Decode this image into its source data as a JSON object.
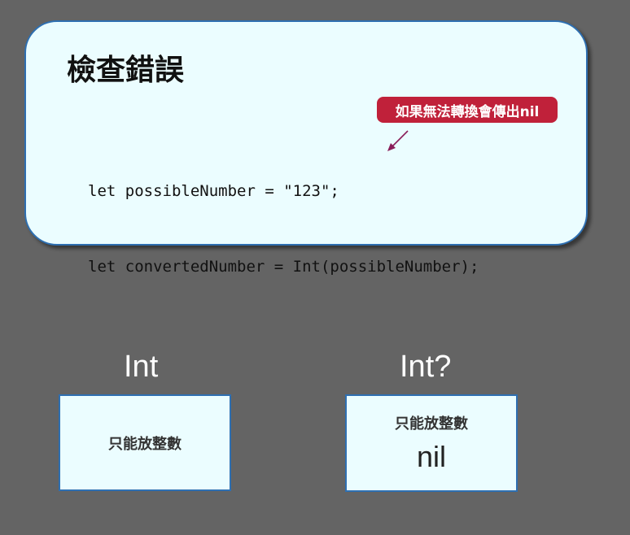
{
  "card": {
    "title": "檢查錯誤",
    "code_lines": [
      "let possibleNumber = \"123\";",
      "let convertedNumber = Int(possibleNumber);"
    ],
    "note": "如果無法轉換會傳出nil"
  },
  "left": {
    "label": "Int",
    "box_text": "只能放整數"
  },
  "right": {
    "label": "Int?",
    "box_text": "只能放整數",
    "box_value": "nil"
  },
  "colors": {
    "background": "#646464",
    "card_fill": "#ebfdff",
    "card_border": "#2e6fb1",
    "note_fill": "#c0213a",
    "arrow": "#8a1e5a"
  }
}
